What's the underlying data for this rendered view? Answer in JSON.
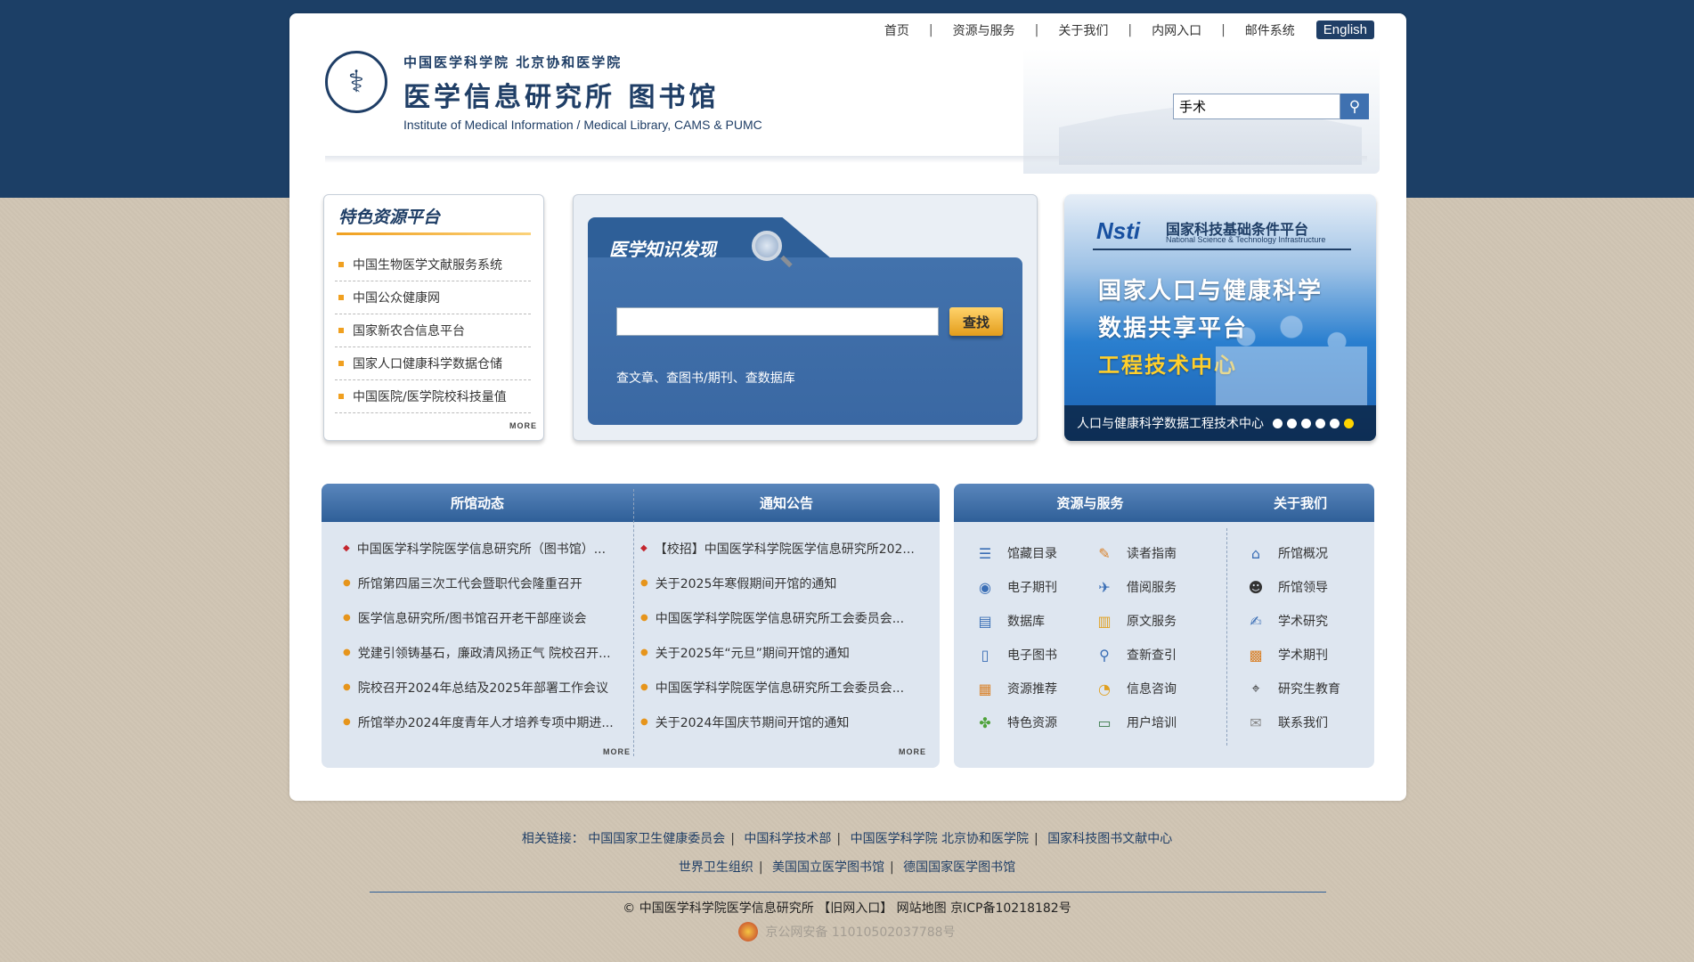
{
  "topnav": {
    "items": [
      "首页",
      "资源与服务",
      "关于我们",
      "内网入口",
      "邮件系统"
    ],
    "separator": "|",
    "english": "English"
  },
  "header": {
    "line1": "中国医学科学院 北京协和医学院",
    "line2": "医学信息研究所 图书馆",
    "line3": "Institute of Medical Information / Medical Library, CAMS & PUMC",
    "search_value": "手术"
  },
  "featured": {
    "title": "特色资源平台",
    "items": [
      "中国生物医学文献服务系统",
      "中国公众健康网",
      "国家新农合信息平台",
      "国家人口健康科学数据仓储",
      "中国医院/医学院校科技量值"
    ],
    "more": "MORE"
  },
  "discovery": {
    "title": "医学知识发现",
    "button": "查找",
    "hint": "查文章、查图书/期刊、查数据库"
  },
  "banner": {
    "logo": "Nsti",
    "org_cn": "国家科技基础条件平台",
    "org_en": "National Science & Technology Infrastructure",
    "title1": "国家人口与健康科学",
    "title2": "数据共享平台",
    "title3": "工程技术中心",
    "caption": "人口与健康科学数据工程技术中心"
  },
  "news": {
    "col1_title": "所馆动态",
    "col2_title": "通知公告",
    "col1": [
      "中国医学科学院医学信息研究所（图书馆）...",
      "所馆第四届三次工代会暨职代会隆重召开",
      "医学信息研究所/图书馆召开老干部座谈会",
      "党建引领铸基石，廉政清风扬正气 院校召开...",
      "院校召开2024年总结及2025年部署工作会议",
      "所馆举办2024年度青年人才培养专项中期进..."
    ],
    "col2": [
      "【校招】中国医学科学院医学信息研究所202...",
      "关于2025年寒假期间开馆的通知",
      "中国医学科学院医学信息研究所工会委员会...",
      "关于2025年“元旦”期间开馆的通知",
      "中国医学科学院医学信息研究所工会委员会...",
      "关于2024年国庆节期间开馆的通知"
    ],
    "more": "MORE"
  },
  "services": {
    "title": "资源与服务",
    "about_title": "关于我们",
    "col1": [
      "馆藏目录",
      "电子期刊",
      "数据库",
      "电子图书",
      "资源推荐",
      "特色资源"
    ],
    "col2": [
      "读者指南",
      "借阅服务",
      "原文服务",
      "查新查引",
      "信息咨询",
      "用户培训"
    ],
    "about": [
      "所馆概况",
      "所馆领导",
      "学术研究",
      "学术期刊",
      "研究生教育",
      "联系我们"
    ]
  },
  "footer": {
    "related_label": "相关链接：",
    "row1": [
      "中国国家卫生健康委员会",
      "中国科学技术部",
      "中国医学科学院 北京协和医学院",
      "国家科技图书文献中心"
    ],
    "row2": [
      "世界卫生组织",
      "美国国立医学图书馆",
      "德国国家医学图书馆"
    ],
    "copyright": "© 中国医学科学院医学信息研究所 【旧网入口】 网站地图 京ICP备10218182号",
    "police": "京公网安备 11010502037788号"
  }
}
